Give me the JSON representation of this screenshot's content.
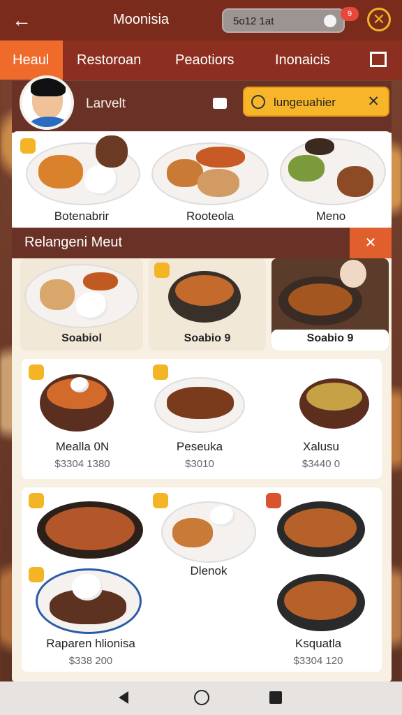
{
  "app": {
    "title": "Moonisia",
    "back_label": "←",
    "search_text": "5o12 1at",
    "badge": "9",
    "close": "✕"
  },
  "tabs": [
    {
      "label": "Heaul"
    },
    {
      "label": "Restoroan"
    },
    {
      "label": "Peaotiors"
    },
    {
      "label": "Inonaicis"
    }
  ],
  "header": {
    "username": "Larvelt",
    "pill_text": "lungeuahier",
    "pill_close": "✕"
  },
  "top_cards": [
    {
      "label": "Botenabrir"
    },
    {
      "label": "Rooteola"
    },
    {
      "label": "Meno"
    }
  ],
  "section": {
    "title": "Relangeni Meut",
    "button": "✕"
  },
  "strip_cards": [
    {
      "label": "Soabiol"
    },
    {
      "label": "Soabio 9"
    },
    {
      "label": "Soabio 9"
    }
  ],
  "grid_row1": [
    {
      "label": "Mealla 0N",
      "price": "$3304 1380"
    },
    {
      "label": "Peseuka",
      "price": "$3010"
    },
    {
      "label": "Xalusu",
      "price": "$3440 0"
    }
  ],
  "grid_row2": [
    {
      "label": "Dlenok"
    },
    {
      "label": "Raparen hlionisa",
      "price": "$338 200"
    },
    {
      "label": "Ksquatla",
      "price": "$3304 120"
    }
  ]
}
